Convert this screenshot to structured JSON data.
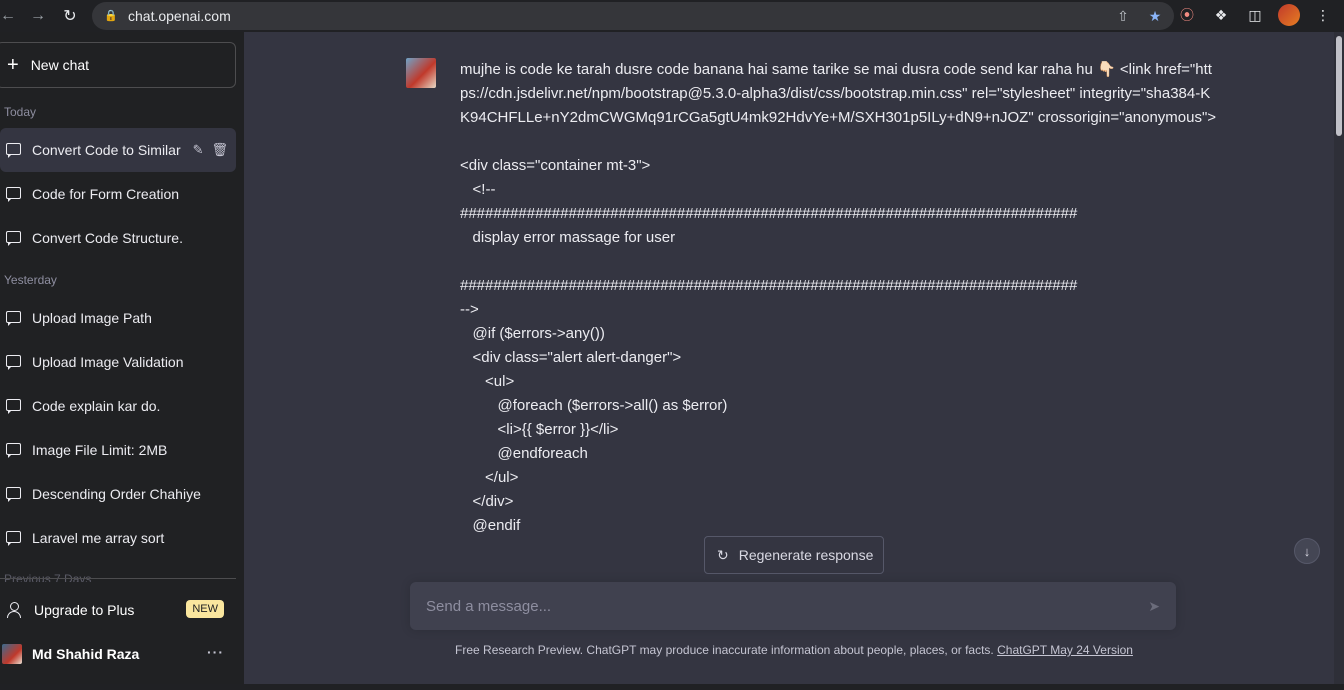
{
  "browser": {
    "url": "chat.openai.com"
  },
  "sidebar": {
    "new_chat_label": "New chat",
    "sections": {
      "today": "Today",
      "yesterday": "Yesterday",
      "previous": "Previous 7 Days"
    },
    "items": [
      {
        "label": "Convert Code to Similar",
        "active": true
      },
      {
        "label": "Code for Form Creation"
      },
      {
        "label": "Convert Code Structure."
      },
      {
        "label": "Upload Image Path"
      },
      {
        "label": "Upload Image Validation"
      },
      {
        "label": "Code explain kar do."
      },
      {
        "label": "Image File Limit: 2MB"
      },
      {
        "label": "Descending Order Chahiye"
      },
      {
        "label": "Laravel me array sort"
      }
    ],
    "upgrade_label": "Upgrade to Plus",
    "new_badge": "NEW",
    "user_name": "Md Shahid Raza",
    "more_label": "···"
  },
  "conversation": {
    "message": "mujhe is code ke tarah dusre code banana hai same tarike se mai dusra code send kar raha hu 👇🏻 <link href=\"https://cdn.jsdelivr.net/npm/bootstrap@5.3.0-alpha3/dist/css/bootstrap.min.css\" rel=\"stylesheet\" integrity=\"sha384-KK94CHFLLe+nY2dmCWGMq91rCGa5gtU4mk92HdvYe+M/SXH301p5ILy+dN9+nJOZ\" crossorigin=\"anonymous\">\n\n<div class=\"container mt-3\">\n   <!--\n##########################################################################\n   display error massage for user\n\n##########################################################################\n-->\n   @if ($errors->any())\n   <div class=\"alert alert-danger\">\n      <ul>\n         @foreach ($errors->all() as $error)\n         <li>{{ $error }}</li>\n         @endforeach\n      </ul>\n   </div>\n   @endif"
  },
  "actions": {
    "regenerate_label": "Regenerate response"
  },
  "composer": {
    "placeholder": "Send a message..."
  },
  "footer": {
    "note": "Free Research Preview. ChatGPT may produce inaccurate information about people, places, or facts. ",
    "version_link": "ChatGPT May 24 Version"
  }
}
